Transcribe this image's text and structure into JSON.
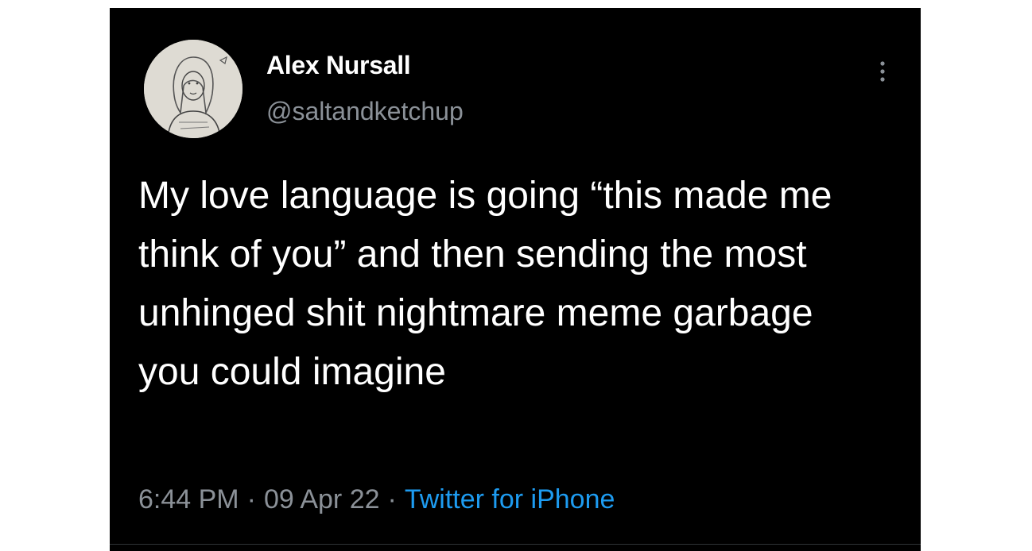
{
  "tweet": {
    "author_name": "Alex Nursall",
    "author_handle": "@saltandketchup",
    "text": "My love language is going “this made me think of you” and then sending the most unhinged shit nightmare meme garbage you could imagine",
    "time": "6:44 PM",
    "date": "09 Apr 22",
    "separator": "·",
    "source": "Twitter for iPhone",
    "avatar_icon": "sketch-portrait-avatar",
    "more_icon": "vertical-ellipsis-icon"
  },
  "colors": {
    "background": "#000000",
    "text": "#ffffff",
    "secondary_text": "#8b9198",
    "link": "#1d9bf0"
  }
}
